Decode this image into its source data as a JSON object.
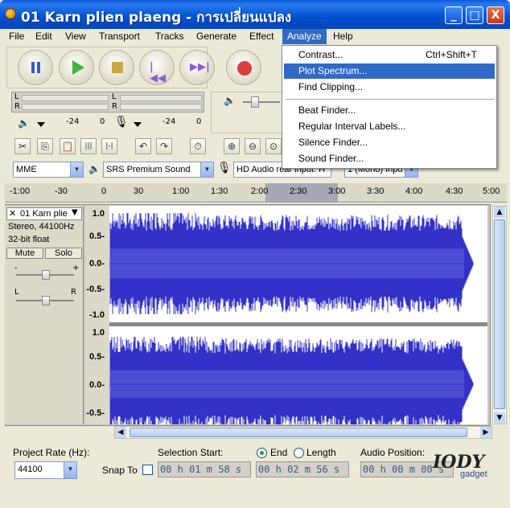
{
  "window": {
    "title": "01 Karn plien plaeng - การเปลี่ยนแปลง",
    "minimize": "_",
    "maximize": "□",
    "close": "X"
  },
  "menubar": [
    "File",
    "Edit",
    "View",
    "Transport",
    "Tracks",
    "Generate",
    "Effect",
    "Analyze",
    "Help"
  ],
  "analyze_menu": [
    {
      "label": "Contrast...",
      "shortcut": "Ctrl+Shift+T"
    },
    {
      "label": "Plot Spectrum...",
      "shortcut": ""
    },
    {
      "label": "Find Clipping...",
      "shortcut": ""
    },
    {
      "label": "Beat Finder...",
      "shortcut": ""
    },
    {
      "label": "Regular Interval Labels...",
      "shortcut": ""
    },
    {
      "label": "Silence Finder...",
      "shortcut": ""
    },
    {
      "label": "Sound Finder...",
      "shortcut": ""
    }
  ],
  "meters": {
    "left_label": "L",
    "right_label": "R",
    "ticks_play": [
      "-24",
      "0"
    ],
    "ticks_rec": [
      "-24",
      "0"
    ]
  },
  "devices": {
    "host": "MME",
    "output": "SRS Premium Sound",
    "input": "HD Audio rear input: H",
    "channels": "1 (Mono) Inpu"
  },
  "ruler": [
    "-1:00",
    "-30",
    "0",
    "30",
    "1:00",
    "1:30",
    "2:00",
    "2:30",
    "3:00",
    "3:30",
    "4:00",
    "4:30",
    "5:00"
  ],
  "track": {
    "name": "01 Karn plie",
    "info1": "Stereo, 44100Hz",
    "info2": "32-bit float",
    "mute": "Mute",
    "solo": "Solo",
    "pan_l": "L",
    "pan_r": "R",
    "gain_minus": "-",
    "gain_plus": "+"
  },
  "yaxis_top": [
    "1.0",
    "0.5-",
    "0.0-",
    "-0.5-",
    "-1.0"
  ],
  "yaxis_bot": [
    "1.0",
    "0.5-",
    "0.0-",
    "-0.5-"
  ],
  "bottom": {
    "rate_label": "Project Rate (Hz):",
    "rate_value": "44100",
    "snap_label": "Snap To",
    "sel_start_label": "Selection Start:",
    "end_label": "End",
    "length_label": "Length",
    "audio_pos_label": "Audio Position:",
    "sel_start": "00 h 01 m 58 s",
    "end_value": "00 h 02 m 56 s",
    "audio_pos": "00 h 00 m 00 s"
  },
  "watermark": {
    "main": "IODY",
    "sub": "gadget"
  },
  "colors": {
    "waveform": "#3232c8",
    "waveform_light": "#6464dc",
    "selection": "#a8a8b4",
    "accent": "#316ac5"
  }
}
